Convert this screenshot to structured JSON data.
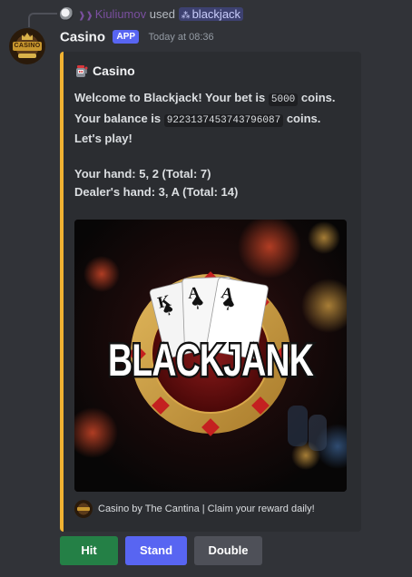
{
  "reply": {
    "user": "Kiuliumov",
    "used_label": "used",
    "command": "blackjack"
  },
  "message": {
    "author": "Casino",
    "badge": "APP",
    "timestamp": "Today at 08:36",
    "avatar_text": "CASINO"
  },
  "embed": {
    "accent_color": "#f0b232",
    "author_name": "Casino",
    "desc": {
      "welcome_prefix": "Welcome to Blackjack! Your bet is",
      "bet": "5000",
      "coins_1": "coins.",
      "balance_prefix": "Your balance is",
      "balance": "9223137453743796087",
      "coins_2": "coins.",
      "lets_play": "Let's play!",
      "your_hand": "Your hand: 5, 2 (Total: 7)",
      "dealer_hand": "Dealer's hand: 3, A (Total: 14)"
    },
    "image": {
      "wordmark": "BLACKJANK",
      "cards": [
        "K",
        "A",
        "A"
      ]
    },
    "footer": "Casino by The Cantina | Claim your reward daily!"
  },
  "buttons": {
    "hit": "Hit",
    "stand": "Stand",
    "double": "Double"
  },
  "colors": {
    "background": "#313338",
    "embed_bg": "#2b2d31",
    "success": "#248046",
    "primary": "#5865f2",
    "secondary": "#4e5058",
    "app_badge": "#5865f2"
  }
}
